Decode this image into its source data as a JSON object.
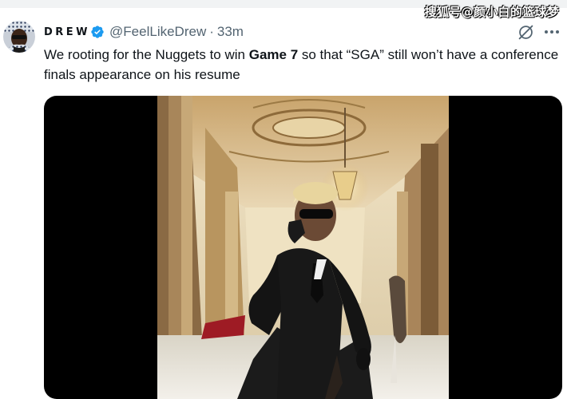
{
  "watermark": "搜狐号@颜小白的篮球梦",
  "tweet": {
    "display_name": "DREW",
    "handle": "@FeelLikeDrew",
    "separator": "·",
    "time": "33m",
    "text_before": "We rooting for the Nuggets to win ",
    "text_bold": "Game 7",
    "text_after": " so that “SGA” still won’t have a conference finals appearance on his resume",
    "media": {
      "type": "video"
    }
  },
  "colors": {
    "verified": "#1d9bf0",
    "secondary_text": "#536471",
    "primary_text": "#0f1419",
    "media_background": "#000000"
  },
  "icons": [
    "verified-badge-icon",
    "grok-icon",
    "more-options-icon"
  ]
}
